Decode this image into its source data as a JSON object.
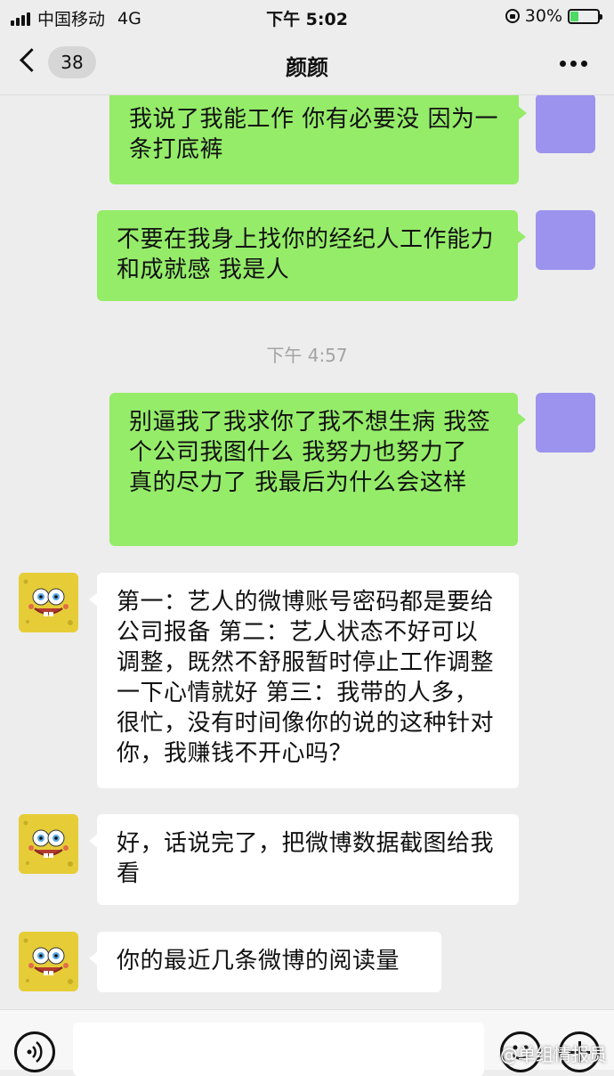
{
  "status_bar": {
    "carrier": "中国移动",
    "network": "4G",
    "time": "下午 5:02",
    "battery_percent": "30%",
    "battery_level": 0.3
  },
  "nav": {
    "unread_count": "38",
    "title": "颜颜"
  },
  "messages": [
    {
      "side": "sent",
      "text": "我说了我能工作 你有必要没 因为一条打底裤"
    },
    {
      "side": "sent",
      "text": "不要在我身上找你的经纪人工作能力和成就感 我是人"
    },
    {
      "timestamp": "下午 4:57"
    },
    {
      "side": "sent",
      "text": "别逼我了我求你了我不想生病 我签个公司我图什么 我努力也努力了 真的尽力了 我最后为什么会这样"
    },
    {
      "side": "received",
      "text": "第一：艺人的微博账号密码都是要给公司报备 第二：艺人状态不好可以调整，既然不舒服暂时停止工作调整一下心情就好 第三：我带的人多，很忙，没有时间像你的说的这种针对你，我赚钱不开心吗？"
    },
    {
      "side": "received",
      "text": "好，话说完了，把微博数据截图给我看"
    },
    {
      "side": "received",
      "text": "你的最近几条微博的阅读量"
    }
  ],
  "watermark": "@单组情报员",
  "colors": {
    "sent_bubble": "#95ec69",
    "received_bubble": "#ffffff",
    "background": "#ededed",
    "my_avatar": "#9b93ee"
  },
  "icons": [
    "signal-icon",
    "lock-icon",
    "battery-icon",
    "back-icon",
    "more-icon",
    "voice-icon",
    "emoji-icon",
    "plus-icon"
  ]
}
